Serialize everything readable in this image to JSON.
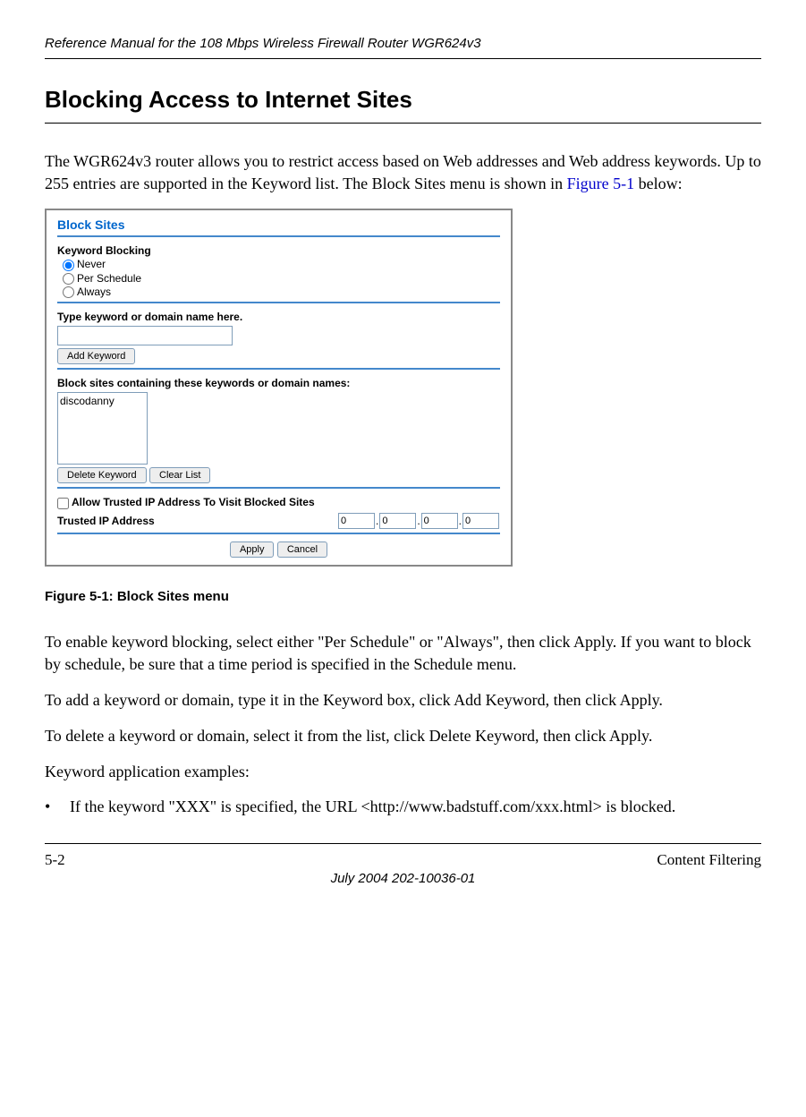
{
  "header": {
    "title": "Reference Manual for the 108 Mbps Wireless Firewall Router WGR624v3"
  },
  "section": {
    "heading": "Blocking Access to Internet Sites"
  },
  "intro": {
    "text_before_link": "The WGR624v3 router allows you to restrict access based on Web addresses and Web address keywords. Up to 255 entries are supported in the Keyword list. The Block Sites menu is shown in ",
    "link": "Figure 5-1",
    "text_after_link": " below:"
  },
  "panel": {
    "title": "Block Sites",
    "keyword_blocking_label": "Keyword Blocking",
    "radio_never": "Never",
    "radio_per_schedule": "Per Schedule",
    "radio_always": "Always",
    "type_keyword_label": "Type keyword or domain name here.",
    "add_keyword_button": "Add Keyword",
    "block_sites_label": "Block sites containing these keywords or domain names:",
    "list_item": "discodanny",
    "delete_keyword_button": "Delete Keyword",
    "clear_list_button": "Clear List",
    "allow_trusted_label": "Allow Trusted IP Address To Visit Blocked Sites",
    "trusted_ip_label": "Trusted IP Address",
    "ip": {
      "a": "0",
      "b": "0",
      "c": "0",
      "d": "0"
    },
    "apply_button": "Apply",
    "cancel_button": "Cancel"
  },
  "figure": {
    "caption": "Figure 5-1:  Block Sites menu"
  },
  "para1": "To enable keyword blocking, select either \"Per Schedule\" or \"Always\", then click Apply. If you want to block by schedule, be sure that a time period is specified in the Schedule menu.",
  "para2": "To add a keyword or domain, type it in the Keyword box, click Add Keyword, then click Apply.",
  "para3": "To delete a keyword or domain, select it from the list, click Delete Keyword, then click Apply.",
  "para4": "Keyword application examples:",
  "bullet1": "If the keyword \"XXX\" is specified, the URL <http://www.badstuff.com/xxx.html> is blocked.",
  "footer": {
    "left": "5-2",
    "right": "Content Filtering",
    "center": "July 2004 202-10036-01"
  }
}
